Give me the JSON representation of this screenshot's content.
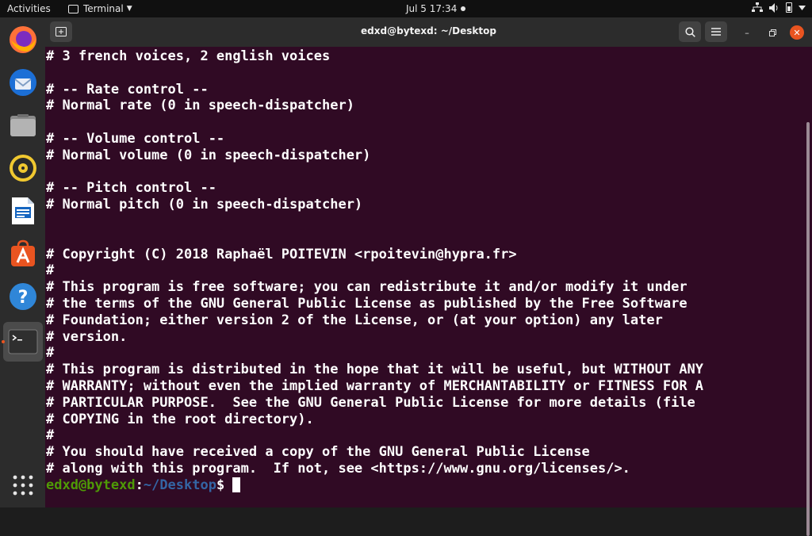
{
  "topbar": {
    "activities": "Activities",
    "app_name": "Terminal",
    "clock": "Jul 5  17:34"
  },
  "dock": {
    "items": [
      {
        "name": "firefox"
      },
      {
        "name": "thunderbird"
      },
      {
        "name": "files"
      },
      {
        "name": "rhythmbox"
      },
      {
        "name": "libreoffice-writer"
      },
      {
        "name": "ubuntu-software"
      },
      {
        "name": "help"
      },
      {
        "name": "terminal"
      }
    ]
  },
  "window": {
    "title": "edxd@bytexd: ~/Desktop"
  },
  "terminal": {
    "lines": [
      "# 3 french voices, 2 english voices",
      "",
      "# -- Rate control --",
      "# Normal rate (0 in speech-dispatcher)",
      "",
      "# -- Volume control --",
      "# Normal volume (0 in speech-dispatcher)",
      "",
      "# -- Pitch control --",
      "# Normal pitch (0 in speech-dispatcher)",
      "",
      "",
      "# Copyright (C) 2018 Raphaël POITEVIN <rpoitevin@hypra.fr>",
      "#",
      "# This program is free software; you can redistribute it and/or modify it under",
      "# the terms of the GNU General Public License as published by the Free Software",
      "# Foundation; either version 2 of the License, or (at your option) any later",
      "# version.",
      "#",
      "# This program is distributed in the hope that it will be useful, but WITHOUT ANY",
      "# WARRANTY; without even the implied warranty of MERCHANTABILITY or FITNESS FOR A",
      "# PARTICULAR PURPOSE.  See the GNU General Public License for more details (file",
      "# COPYING in the root directory).",
      "#",
      "# You should have received a copy of the GNU General Public License",
      "# along with this program.  If not, see <https://www.gnu.org/licenses/>."
    ],
    "prompt_user": "edxd@bytexd",
    "prompt_sep": ":",
    "prompt_path": "~/Desktop",
    "prompt_symbol": "$ "
  },
  "colors": {
    "terminal_bg": "#300a24",
    "prompt_user": "#4e9a06",
    "prompt_path": "#3465a4",
    "accent": "#e95420"
  }
}
